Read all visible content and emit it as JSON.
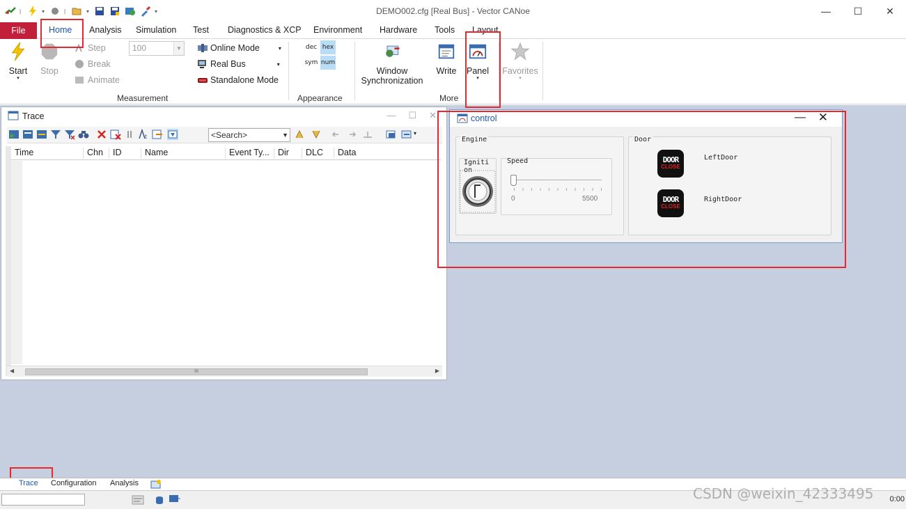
{
  "window": {
    "title": "DEMO002.cfg [Real Bus] - Vector CANoe",
    "minimize": "—",
    "maximize": "☐",
    "close": "✕"
  },
  "ribbon_tabs": [
    "File",
    "Home",
    "Analysis",
    "Simulation",
    "Test",
    "Diagnostics & XCP",
    "Environment",
    "Hardware",
    "Tools",
    "Layout"
  ],
  "ribbon": {
    "start": "Start",
    "stop": "Stop",
    "step": "Step",
    "break": "Break",
    "animate": "Animate",
    "step_value": "100",
    "online_mode": "Online Mode",
    "real_bus": "Real Bus",
    "standalone_mode": "Standalone Mode",
    "measurement_group": "Measurement",
    "fmt_dec": "dec",
    "fmt_hex": "hex",
    "fmt_sym": "sym",
    "fmt_num": "num",
    "appearance_group": "Appearance",
    "window_sync_1": "Window",
    "window_sync_2": "Synchronization",
    "write": "Write",
    "panel": "Panel",
    "favorites": "Favorites",
    "more_group": "More"
  },
  "trace": {
    "title": "Trace",
    "search_placeholder": "<Search>",
    "columns": [
      "Time",
      "Chn",
      "ID",
      "Name",
      "Event Ty...",
      "Dir",
      "DLC",
      "Data"
    ],
    "scroll_grip": "III"
  },
  "control_panel": {
    "title": "control",
    "engine_label": "Engine",
    "ignition_label": "Igniti on",
    "speed_label": "Speed",
    "speed_min": "0",
    "speed_max": "5500",
    "speed_value": 0,
    "door_label": "Door",
    "left_door": "LeftDoor",
    "right_door": "RightDoor",
    "door_btn_top": "DOOR",
    "door_btn_bottom": "CLOSE"
  },
  "bottom_tabs": [
    "Trace",
    "Configuration",
    "Analysis"
  ],
  "status": {
    "time": "0:00"
  },
  "watermark": "CSDN @weixin_42333495",
  "colors": {
    "file_tab": "#c21f3b",
    "accent_blue": "#1b56a7",
    "workspace": "#c6cfe0",
    "highlight_red": "#e8262d"
  }
}
